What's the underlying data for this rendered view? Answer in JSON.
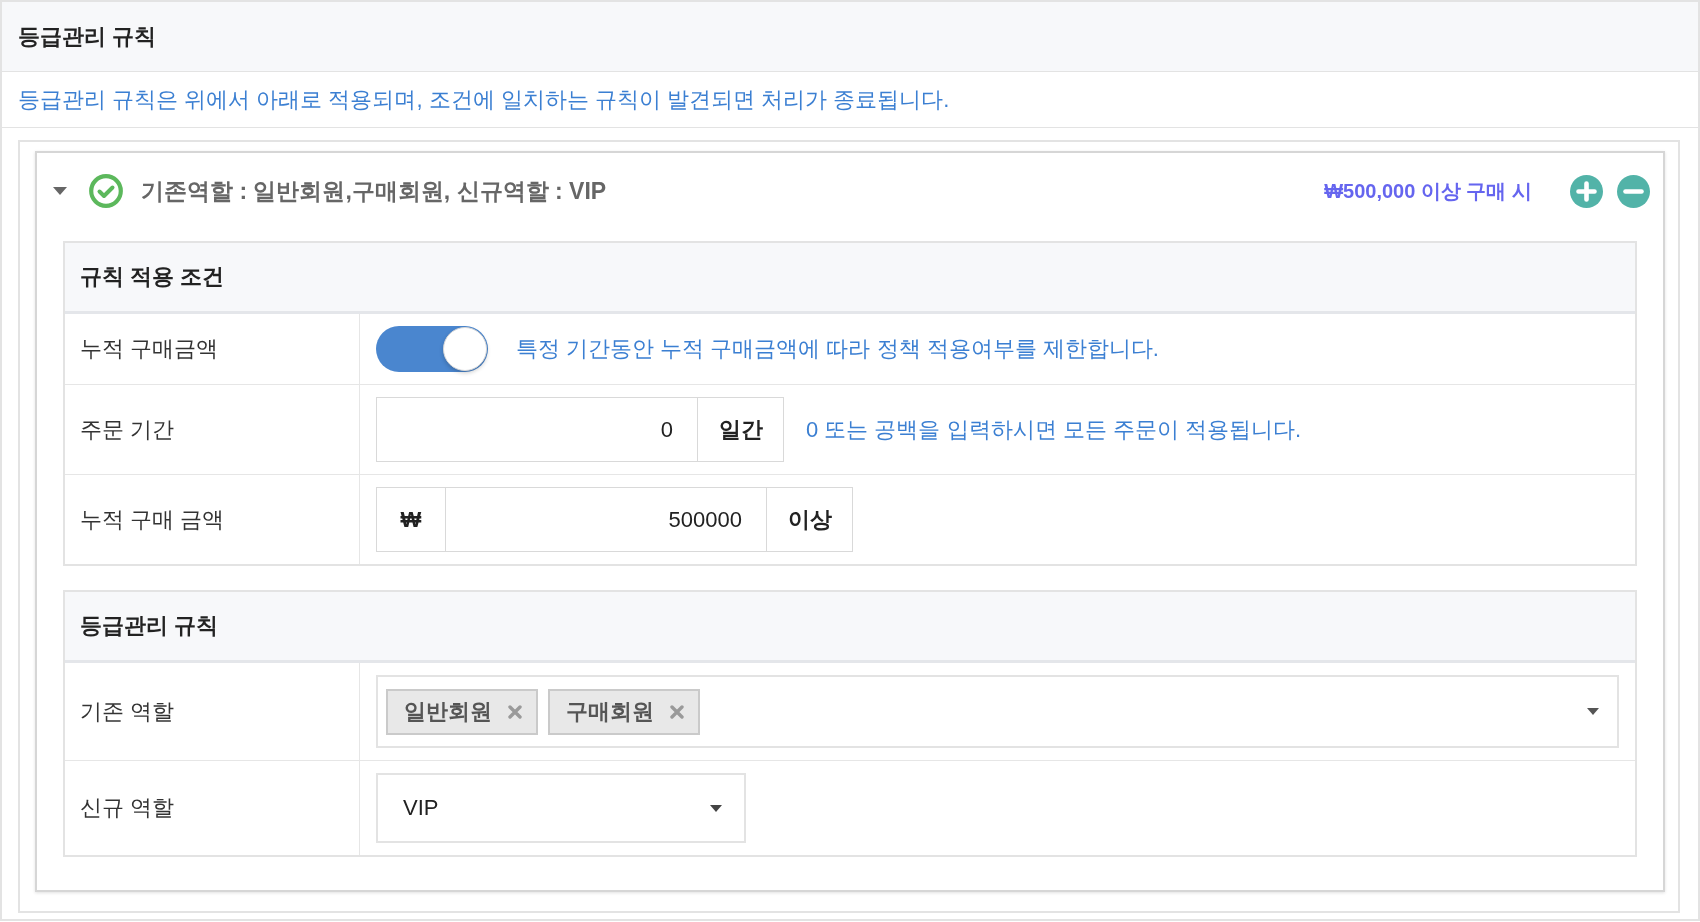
{
  "panel": {
    "title": "등급관리 규칙",
    "description": "등급관리 규칙은 위에서 아래로 적용되며, 조건에 일치하는 규칙이 발견되면 처리가 종료됩니다."
  },
  "rule": {
    "expanded": true,
    "summary": "기존역할 : 일반회원,구매회원, 신규역할 : VIP",
    "condition": "₩500,000 이상 구매 시",
    "sections": [
      {
        "title": "규칙 적용 조건",
        "rows": [
          {
            "kind": "toggle",
            "label": "누적 구매금액",
            "on": true,
            "hint": "특정 기간동안 누적 구매금액에 따라 정책 적용여부를 제한합니다."
          },
          {
            "kind": "input",
            "label": "주문 기간",
            "value": "0",
            "suffix": "일간",
            "hint": "0 또는 공백을 입력하시면 모든 주문이 적용됩니다."
          },
          {
            "kind": "input",
            "label": "누적 구매 금액",
            "prefix": "₩",
            "value": "500000",
            "suffix": "이상"
          }
        ]
      },
      {
        "title": "등급관리 규칙",
        "rows": [
          {
            "kind": "multiselect",
            "label": "기존 역할",
            "tags": [
              "일반회원",
              "구매회원"
            ]
          },
          {
            "kind": "select",
            "label": "신규 역할",
            "value": "VIP"
          }
        ]
      }
    ]
  }
}
